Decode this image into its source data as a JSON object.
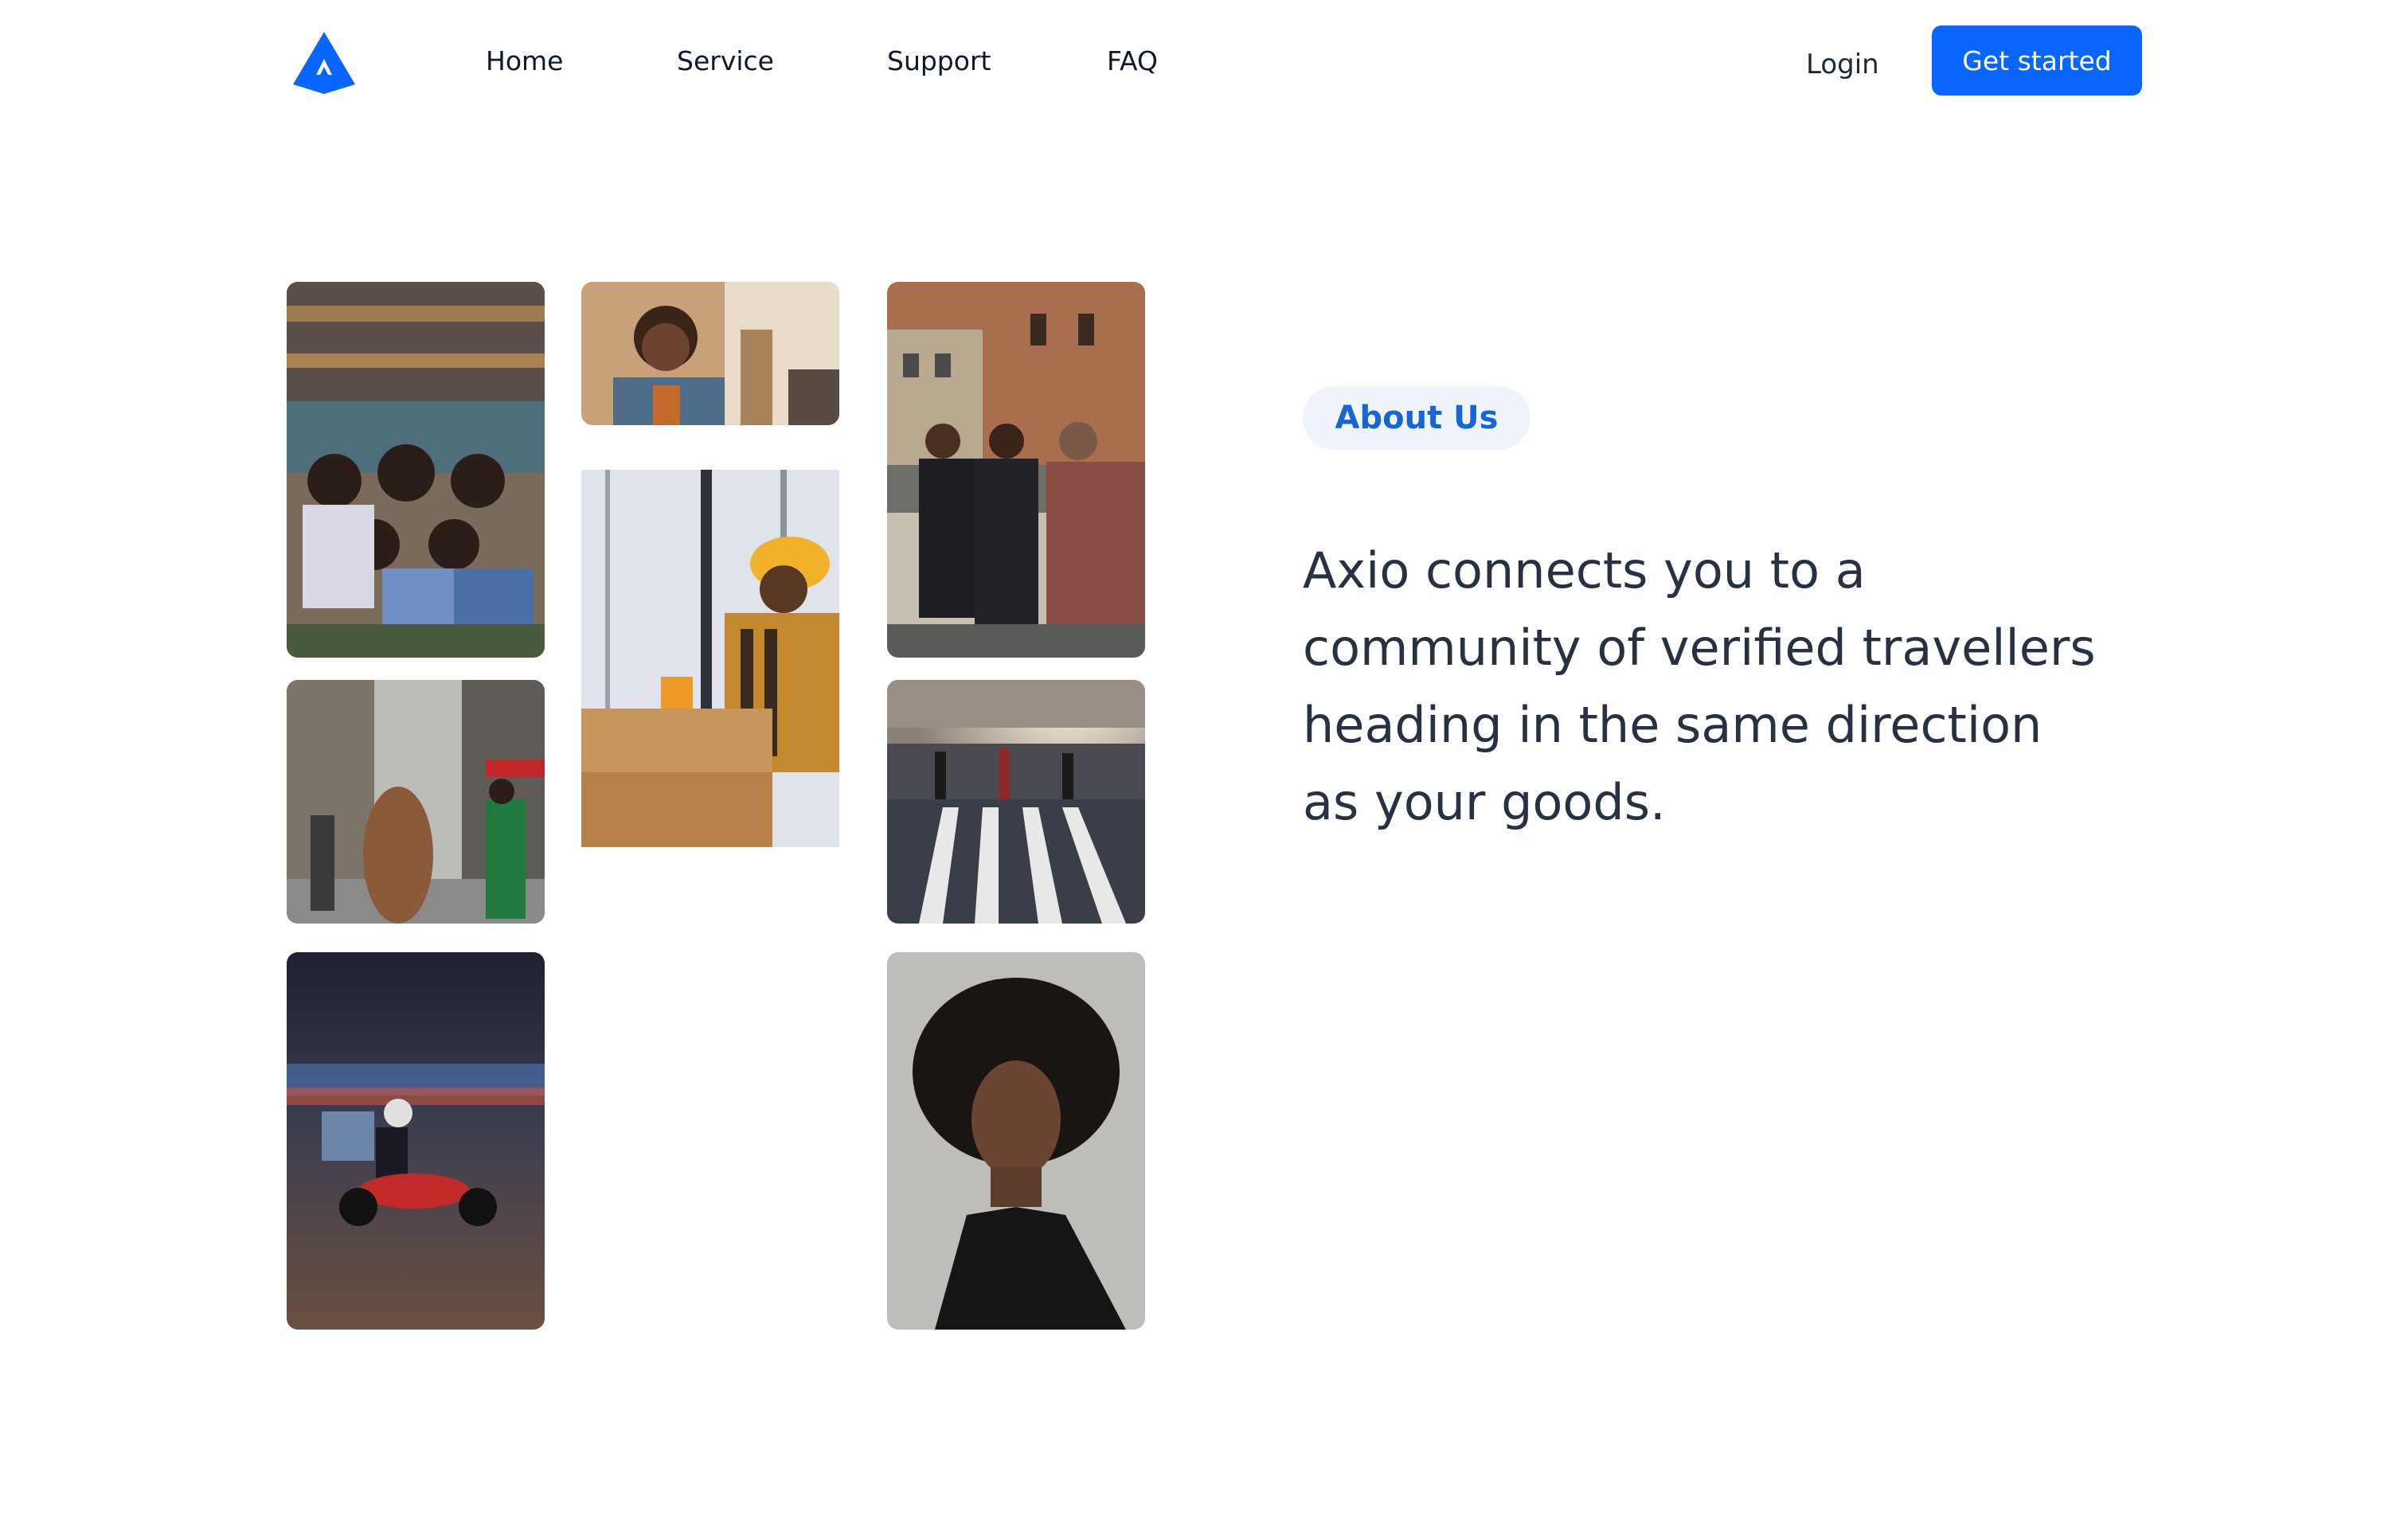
{
  "header": {
    "logo_icon": "axio-triangle-logo-icon",
    "brand_color": "#0866ff",
    "nav": [
      {
        "label": "Home"
      },
      {
        "label": "Service"
      },
      {
        "label": "Support"
      },
      {
        "label": "FAQ"
      }
    ],
    "login_label": "Login",
    "cta_label": "Get started"
  },
  "gallery": {
    "photos": [
      {
        "name": "group-of-women-by-mural"
      },
      {
        "name": "smiling-man-on-city-street"
      },
      {
        "name": "men-laughing-on-sidewalk"
      },
      {
        "name": "pedestrians-busy-street"
      },
      {
        "name": "warehouse-worker-packing-box"
      },
      {
        "name": "crowd-crossing-crosswalk"
      },
      {
        "name": "motorbike-delivery-rider"
      },
      {
        "name": "woman-portrait-afro"
      }
    ]
  },
  "about": {
    "badge": "About Us",
    "badge_color": "#1565d8",
    "lines": [
      "Axio connects you to a",
      "community of verified travellers",
      "heading in the same direction",
      "as your goods."
    ]
  }
}
